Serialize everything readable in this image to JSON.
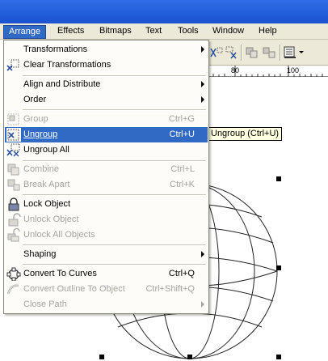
{
  "menubar": {
    "items": [
      {
        "label": "Arrange",
        "active": true
      },
      {
        "label": "Effects"
      },
      {
        "label": "Bitmaps"
      },
      {
        "label": "Text"
      },
      {
        "label": "Tools"
      },
      {
        "label": "Window"
      },
      {
        "label": "Help"
      }
    ]
  },
  "ruler": {
    "labels": [
      "80",
      "100"
    ]
  },
  "tooltip": "Ungroup (Ctrl+U)",
  "menu": {
    "transformations": {
      "label": "Transformations",
      "icon": "transformations-icon"
    },
    "clear_transformations": {
      "label": "Clear Transformations",
      "icon": "clear-transformations-icon"
    },
    "align_distribute": {
      "label": "Align and Distribute"
    },
    "order": {
      "label": "Order"
    },
    "group": {
      "label": "Group",
      "shortcut": "Ctrl+G",
      "icon": "group-icon"
    },
    "ungroup": {
      "label": "Ungroup",
      "shortcut": "Ctrl+U",
      "icon": "ungroup-icon"
    },
    "ungroup_all": {
      "label": "Ungroup All",
      "icon": "ungroup-all-icon"
    },
    "combine": {
      "label": "Combine",
      "shortcut": "Ctrl+L",
      "icon": "combine-icon"
    },
    "break_apart": {
      "label": "Break  Apart",
      "shortcut": "Ctrl+K",
      "icon": "break-apart-icon"
    },
    "lock_object": {
      "label": "Lock Object",
      "icon": "lock-icon"
    },
    "unlock_object": {
      "label": "Unlock Object",
      "icon": "unlock-icon"
    },
    "unlock_all": {
      "label": "Unlock All Objects",
      "icon": "unlock-all-icon"
    },
    "shaping": {
      "label": "Shaping"
    },
    "convert_curves": {
      "label": "Convert To Curves",
      "shortcut": "Ctrl+Q",
      "icon": "convert-to-curves-icon"
    },
    "convert_outline": {
      "label": "Convert Outline To Object",
      "shortcut": "Ctrl+Shift+Q",
      "icon": "convert-outline-icon"
    },
    "close_path": {
      "label": "Close Path"
    }
  },
  "colors": {
    "highlight": "#316ac5",
    "menu_bg": "#fdfcf8",
    "tooltip_bg": "#ffffe1",
    "disabled_text": "#a7a59d"
  }
}
